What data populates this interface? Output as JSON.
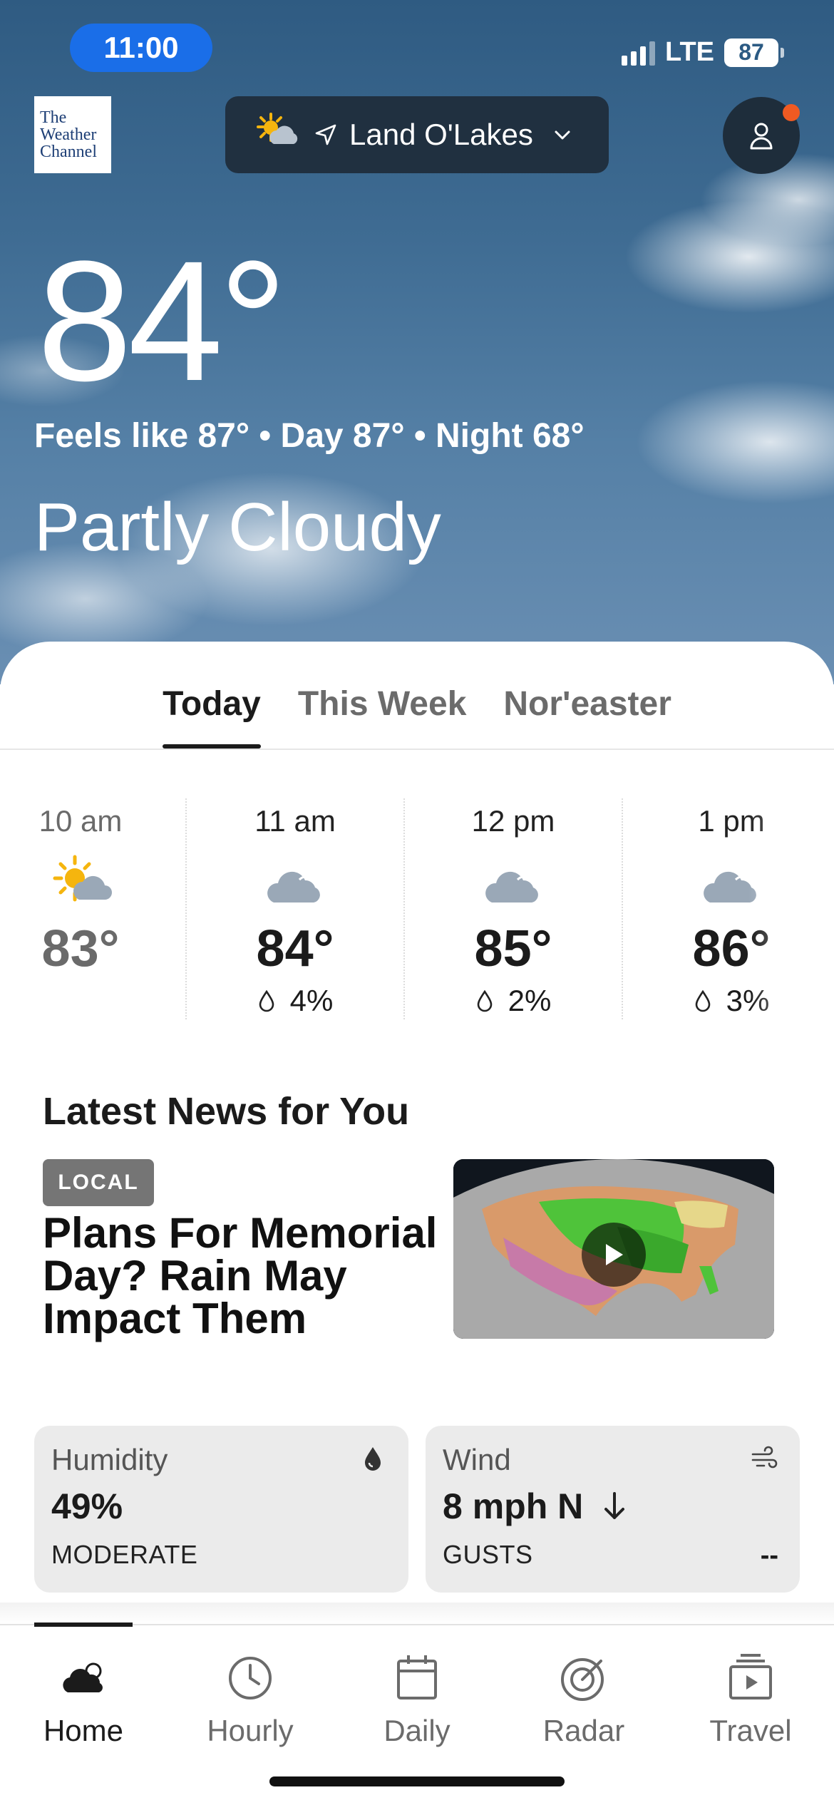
{
  "status_bar": {
    "time": "11:00",
    "network": "LTE",
    "battery": "87"
  },
  "header": {
    "logo_lines": [
      "The",
      "Weather",
      "Channel"
    ],
    "location": "Land O'Lakes"
  },
  "current": {
    "temperature": "84°",
    "details": "Feels like 87° • Day 87° • Night 68°",
    "condition": "Partly Cloudy"
  },
  "tabs": [
    {
      "label": "Today",
      "active": true
    },
    {
      "label": "This Week",
      "active": false
    },
    {
      "label": "Nor'easter",
      "active": false
    }
  ],
  "hourly": [
    {
      "time": "10 am",
      "icon": "partly-sunny-icon",
      "temp": "83°",
      "precip": ""
    },
    {
      "time": "11 am",
      "icon": "cloud-icon",
      "temp": "84°",
      "precip": "4%"
    },
    {
      "time": "12 pm",
      "icon": "cloud-icon",
      "temp": "85°",
      "precip": "2%"
    },
    {
      "time": "1 pm",
      "icon": "cloud-icon",
      "temp": "86°",
      "precip": "3%"
    }
  ],
  "news": {
    "section_title": "Latest News for You",
    "badge": "LOCAL",
    "headline": "Plans For Memorial Day? Rain May Impact Them"
  },
  "cards": {
    "humidity": {
      "label": "Humidity",
      "value": "49%",
      "sub": "MODERATE"
    },
    "wind": {
      "label": "Wind",
      "value": "8 mph N",
      "sub": "GUSTS",
      "gusts": "--"
    }
  },
  "bottom_nav": [
    {
      "label": "Home",
      "icon": "home-cloud-icon",
      "active": true
    },
    {
      "label": "Hourly",
      "icon": "clock-icon",
      "active": false
    },
    {
      "label": "Daily",
      "icon": "calendar-icon",
      "active": false
    },
    {
      "label": "Radar",
      "icon": "radar-icon",
      "active": false
    },
    {
      "label": "Travel",
      "icon": "travel-icon",
      "active": false
    }
  ],
  "colors": {
    "time_pill": "#1a6ee8",
    "notification_dot": "#f05a22",
    "sun": "#f5b50e",
    "cloud": "#9aa8b7"
  }
}
